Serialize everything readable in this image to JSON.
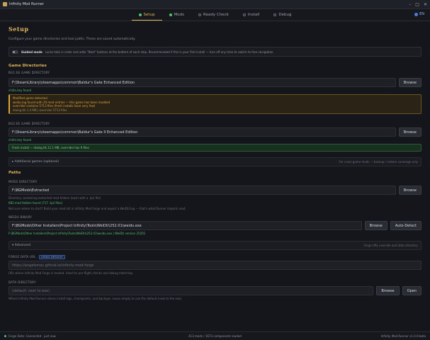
{
  "window": {
    "title": "Infinity Mod Runner"
  },
  "tabs": [
    {
      "label": "Setup"
    },
    {
      "label": "Mods"
    },
    {
      "label": "Ready Check"
    },
    {
      "label": "Install"
    },
    {
      "label": "Debug"
    }
  ],
  "lang": "EN",
  "page": {
    "title": "Setup",
    "subtitle": "Configure your game directories and tool paths. These are saved automatically."
  },
  "guided": {
    "label": "Guided mode",
    "desc": "Locks tabs in order and adds \"Next\" buttons at the bottom of each step. Recommended if this is your first install — turn off any time to switch to free navigation."
  },
  "game_dirs": {
    "title": "Game Directories",
    "bgee_label": "BG1:EE GAME DIRECTORY",
    "bgee_path": "F:\\SteamLibrary\\steamapps\\common\\Baldur's Gate Enhanced Edition",
    "bgee_status": "chitin.key found",
    "warn_title": "Modified game detected",
    "warn_line1": "weidu.log found with 20 mod entries — this game has been modded",
    "warn_line2": "override/ contains 5713 files (fresh installs have very few)",
    "warn_dim": "dialog.tlk 1.4 MB | override/ 5713 files",
    "bg2ee_label": "BG2:EE GAME DIRECTORY",
    "bg2ee_path": "F:\\SteamLibrary\\steamapps\\common\\Baldur's Gate II Enhanced Edition",
    "bg2ee_status": "chitin.key found",
    "bg2ee_ok": "Fresh install — dialog.tlk 11.1 MB, override/ has 9 files",
    "additional": "Additional games (optional)",
    "additional_hint": "For cross-game mods — backup / restore coverage only"
  },
  "paths": {
    "title": "Paths",
    "mods_label": "MODS DIRECTORY",
    "mods_path": "F:\\BGMods\\Extracted",
    "mods_hint": "Directory containing extracted mod folders (each with a .tp2 file)",
    "mods_status": "682 mod folders found (717 .tp2 files)",
    "mods_hint2": "Not sure where to start? Build your mod list in Infinity Mod Forge and export a WeiDU.log — that's what Runner imports next.",
    "weidu_label": "WEIDU BINARY",
    "weidu_path": "F:\\BGMods\\Other Installers\\Project Infinity\\Tools\\WeiDU\\252.01\\weidu.exe",
    "weidu_status": "F:\\BGMods\\Other Installers\\Project Infinity\\Tools\\WeiDU\\252.01\\weidu.exe | WeiDU version 25201",
    "advanced": "Advanced",
    "advanced_hint": "Forge URL override and data directory"
  },
  "forge": {
    "label": "FORGE DATA URL",
    "badge": "USING DEFAULT",
    "placeholder": "https://angelsmac.github.io/infinity-mod-forge",
    "hint": "URL where Infinity Mod Forge is hosted. Used for pre-flight checks and debug matching."
  },
  "datadir": {
    "label": "DATA DIRECTORY",
    "placeholder": "(default: next to exe)",
    "hint": "Where Infinity Mod Runner stores install logs, checkpoints, and backups. Leave empty to use the default (next to the exe)."
  },
  "buttons": {
    "browse": "Browse",
    "auto_detect": "Auto-Detect",
    "open": "Open"
  },
  "status": {
    "left": "Forge Data: Connected · just now",
    "mid": "413 mods / 1673 components loaded",
    "right": "Infinity Mod Runner v1.0.0-beta"
  },
  "colors": {
    "accent": "#e0b45a",
    "ok": "#52c46b",
    "warn": "#e0a23a",
    "bg": "#15161b"
  }
}
